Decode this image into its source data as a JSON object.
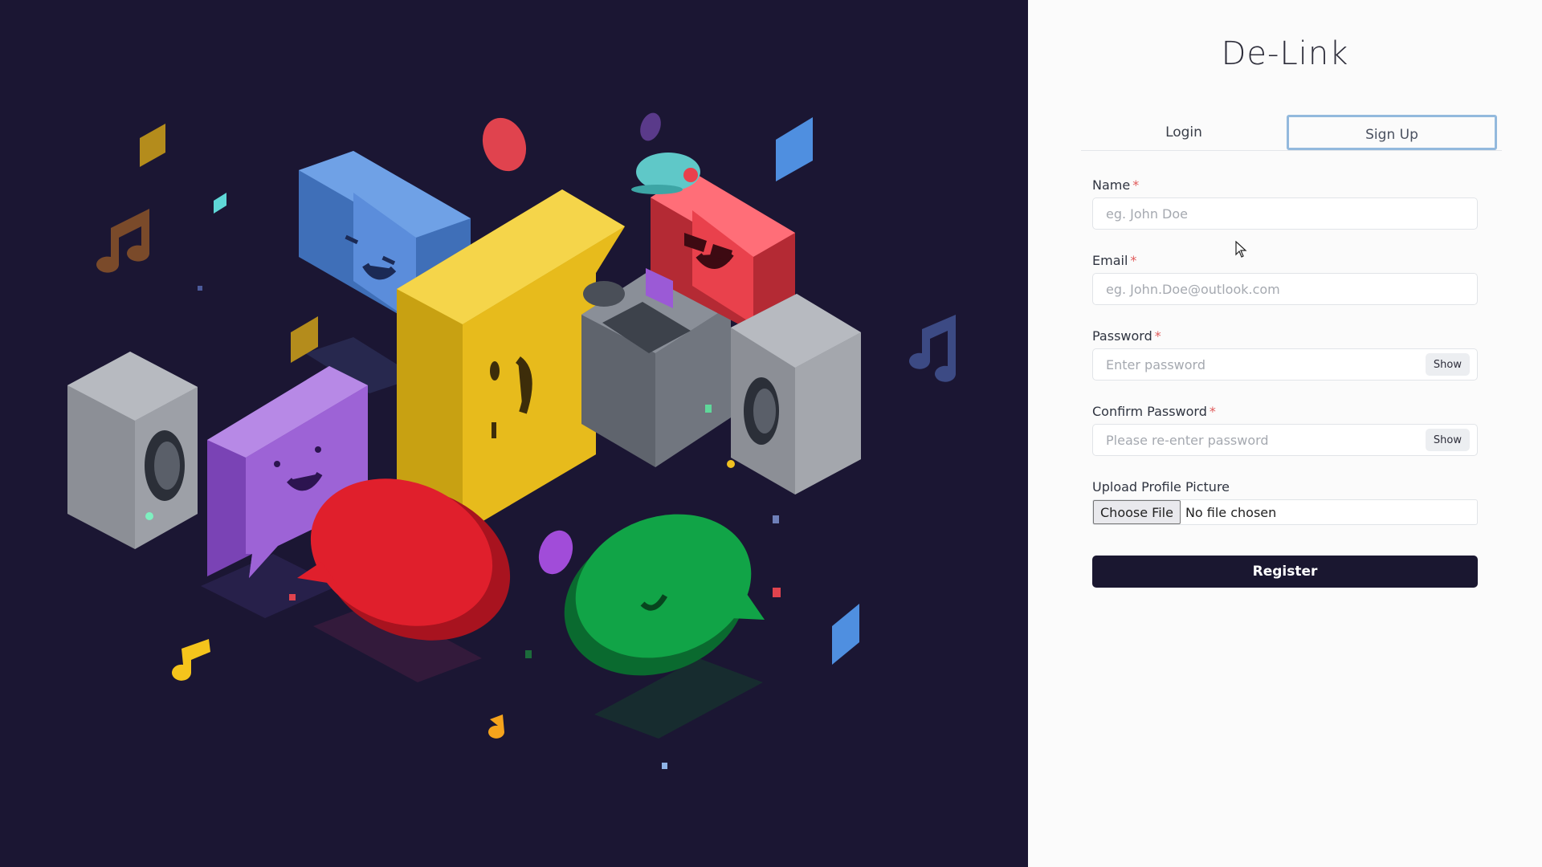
{
  "app": {
    "title": "De-Link"
  },
  "tabs": [
    {
      "label": "Login",
      "active": false
    },
    {
      "label": "Sign Up",
      "active": true
    }
  ],
  "form": {
    "name": {
      "label": "Name",
      "required_mark": "*",
      "placeholder": "eg. John Doe",
      "value": ""
    },
    "email": {
      "label": "Email",
      "required_mark": "*",
      "placeholder": "eg. John.Doe@outlook.com",
      "value": ""
    },
    "password": {
      "label": "Password",
      "required_mark": "*",
      "placeholder": "Enter password",
      "value": "",
      "toggle_label": "Show"
    },
    "confirm_password": {
      "label": "Confirm Password",
      "required_mark": "*",
      "placeholder": "Please re-enter password",
      "value": "",
      "toggle_label": "Show"
    },
    "profile_picture": {
      "label": "Upload Profile Picture",
      "button_label": "Choose File",
      "status": "No file chosen"
    },
    "submit_label": "Register"
  },
  "colors": {
    "hero_background": "#1b1633",
    "panel_background": "#fbfbfb",
    "active_tab_border": "#93b9dd",
    "primary_button": "#1a1730",
    "required_mark": "#e05a5a"
  },
  "illustration": {
    "description_icons": [
      "speaker-icon",
      "chat-bubble-icon",
      "music-note-icon"
    ]
  }
}
